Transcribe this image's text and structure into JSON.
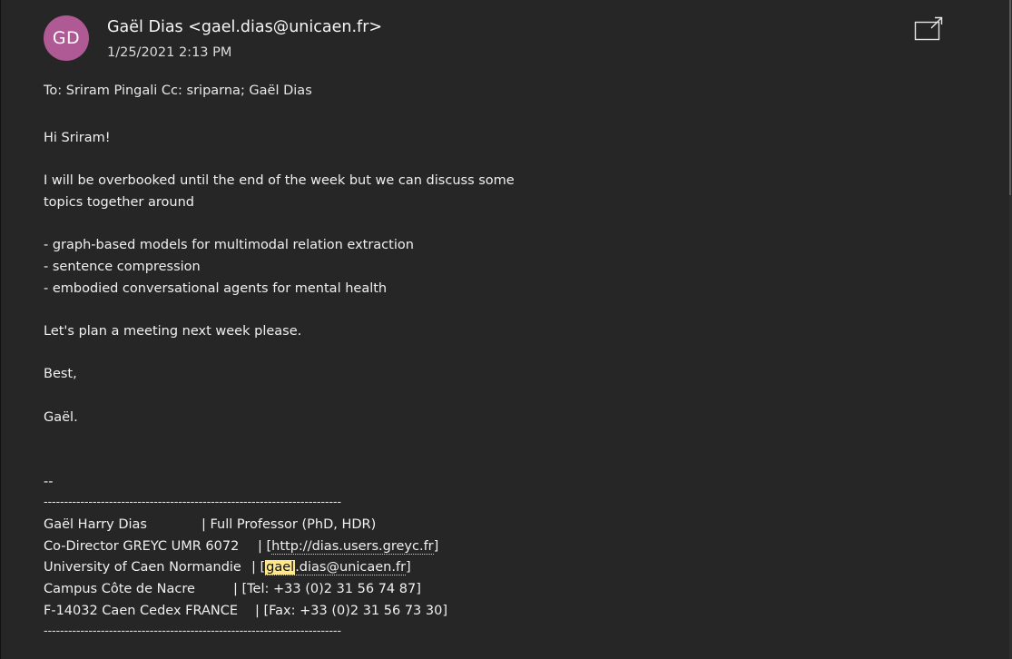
{
  "message": {
    "avatar_initials": "GD",
    "sender": "Gaël Dias <gael.dias@unicaen.fr>",
    "date": "1/25/2021 2:13 PM",
    "recipients": "To: Sriram Pingali Cc: sriparna; Gaël Dias",
    "body": [
      "Hi Sriram!",
      "I will be overbooked until the end of the week but we can discuss some",
      "topics together around",
      "- graph-based models for multimodal relation extraction",
      "- sentence compression",
      "- embodied conversational agents for mental health",
      "Let's plan a meeting next week please.",
      "Best,",
      "Gaël.",
      "--"
    ]
  },
  "signature": {
    "divider": "-------------------------------------------------------------------------",
    "name": "Gaël Harry Dias",
    "title": "| Full Professor (PhD, HDR)",
    "role": "Co-Director GREYC UMR 6072",
    "url_prefix": "| [",
    "url": "http://dias.users.greyc.fr",
    "url_suffix": "]",
    "university": "University of Caen Normandie",
    "email_prefix": "| [",
    "email_highlight": "gael",
    "email_rest": ".dias@unicaen.fr",
    "email_suffix": "]",
    "campus": "Campus Côte de Nacre",
    "tel": "| [Tel: +33 (0)2 31 56 74 87]",
    "city": "F-14032 Caen Cedex FRANCE",
    "fax": "| [Fax: +33 (0)2 31 56 73 30]"
  },
  "colors": {
    "background": "#262626",
    "avatar": "#b05a95",
    "highlight": "#ffe88a"
  },
  "icons": {
    "popout": "popout-window-icon"
  }
}
